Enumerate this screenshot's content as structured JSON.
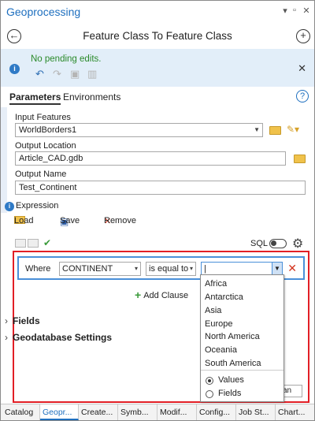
{
  "window": {
    "title": "Geoprocessing",
    "pin": "▾ ",
    "pushpin": "ᵠ",
    "close": "✕"
  },
  "header": {
    "tool_title": "Feature Class To Feature Class",
    "back": "⊖",
    "add": "+"
  },
  "notice": {
    "message": "No pending edits."
  },
  "tabs": [
    {
      "label": "Parameters",
      "active": true
    },
    {
      "label": "Environments",
      "active": false
    }
  ],
  "params": {
    "input_features": {
      "label": "Input Features",
      "value": "WorldBorders1"
    },
    "output_location": {
      "label": "Output Location",
      "value": "Article_CAD.gdb"
    },
    "output_name": {
      "label": "Output Name",
      "value": "Test_Continent"
    }
  },
  "expression": {
    "label": "Expression",
    "load": "Load",
    "save": "Save",
    "remove": "Remove",
    "sql_label": "SQL",
    "where": {
      "label": "Where",
      "field": "CONTINENT",
      "operator": "is equal to",
      "value": "|"
    },
    "add_clause": "Add Clause"
  },
  "sections": {
    "fields": "Fields",
    "geodatabase_settings": "Geodatabase Settings"
  },
  "value_popup": {
    "options": [
      "Africa",
      "Antarctica",
      "Asia",
      "Europe",
      "North America",
      "Oceania",
      "South America"
    ],
    "radio_values": "Values",
    "radio_fields": "Fields",
    "selected_radio": "Values"
  },
  "hidden_select": "an",
  "bottom_tabs": [
    "Catalog",
    "Geopr...",
    "Create...",
    "Symb...",
    "Modif...",
    "Config...",
    "Job St...",
    "Chart..."
  ],
  "colors": {
    "accent": "#1e6fbf",
    "highlight_border": "#e21f26",
    "notice_bg": "#e2eef9",
    "pending_text": "#2a8a2a"
  }
}
